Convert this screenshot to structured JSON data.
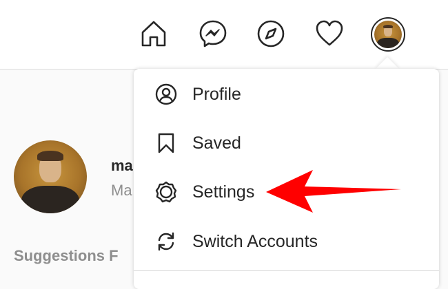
{
  "topbar": {
    "icons": [
      "home-icon",
      "messenger-icon",
      "explore-icon",
      "activity-heart-icon"
    ]
  },
  "profile": {
    "username": "ma",
    "fullname": "Ma"
  },
  "suggestions": {
    "label": "Suggestions F"
  },
  "menu": {
    "items": [
      {
        "label": "Profile",
        "icon": "profile-icon"
      },
      {
        "label": "Saved",
        "icon": "bookmark-icon"
      },
      {
        "label": "Settings",
        "icon": "settings-gear-icon"
      },
      {
        "label": "Switch Accounts",
        "icon": "switch-accounts-icon"
      }
    ]
  },
  "annotation": {
    "arrow_color": "#ff0000",
    "points_to": "Settings"
  }
}
